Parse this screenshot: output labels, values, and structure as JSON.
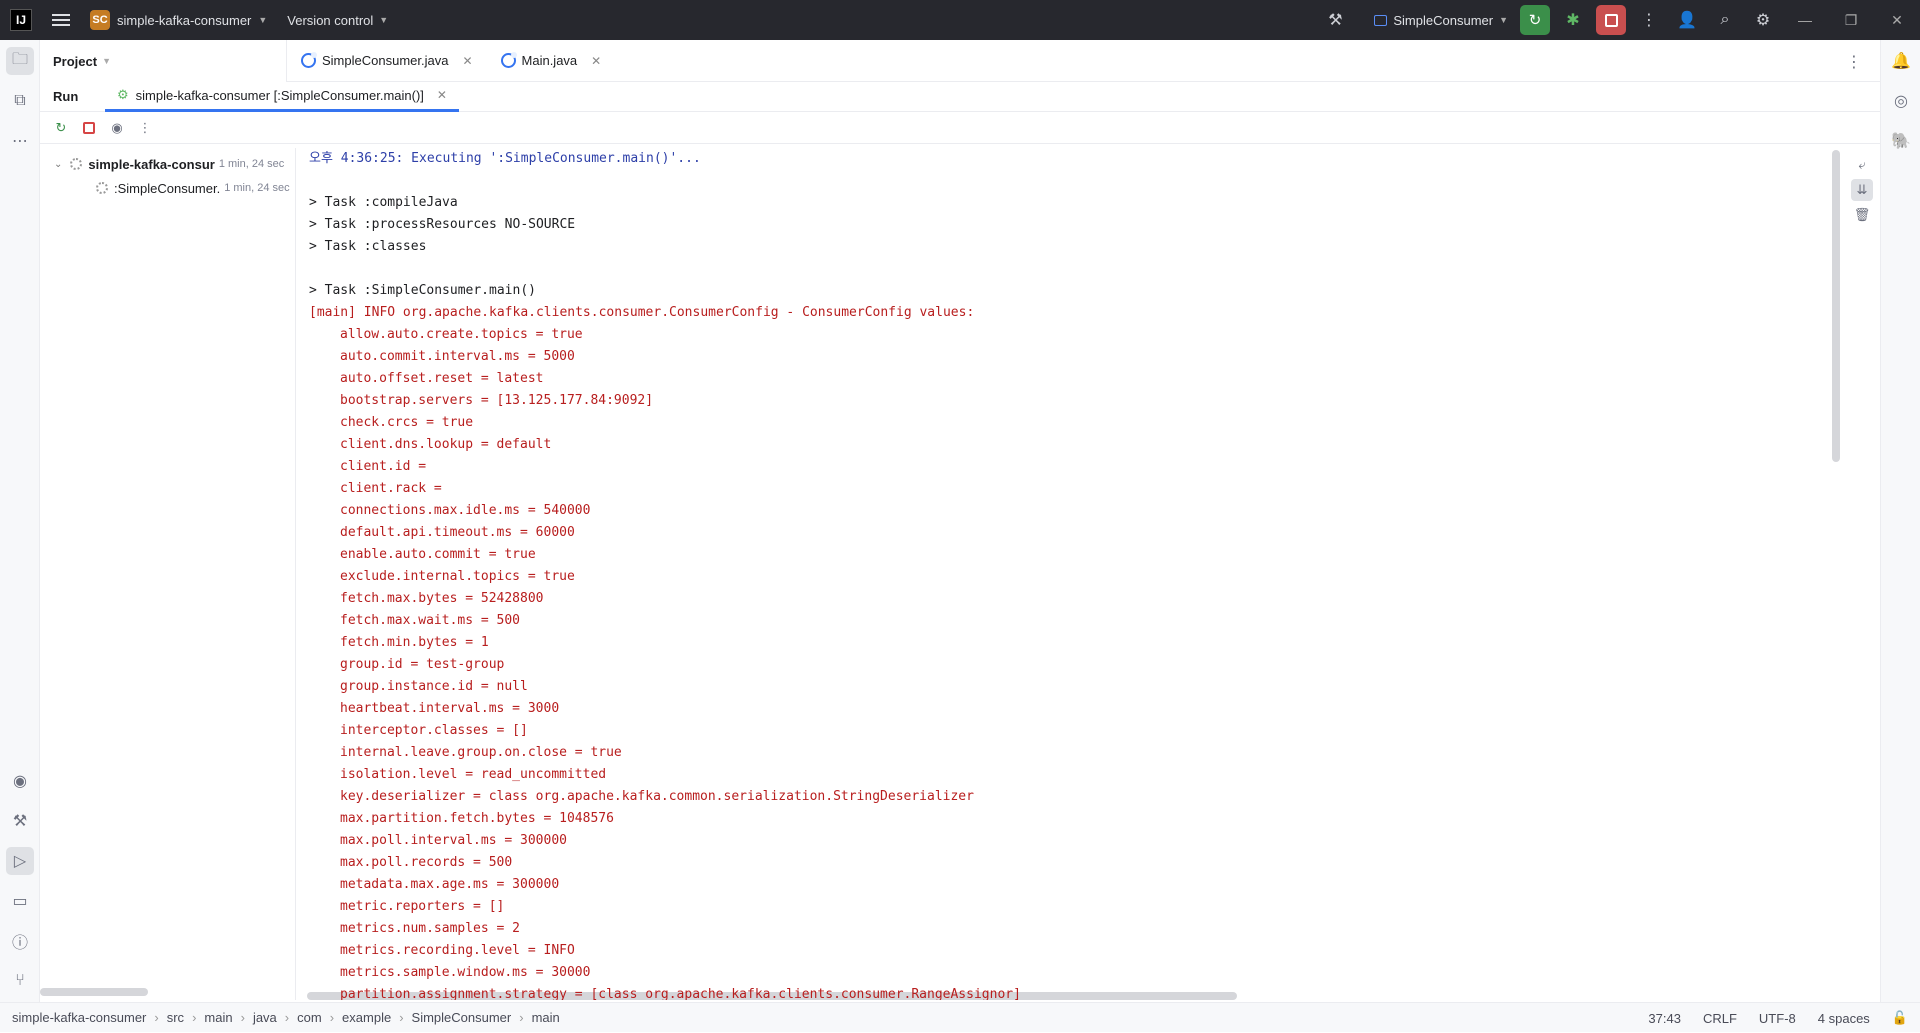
{
  "titlebar": {
    "project_badge": "SC",
    "project_name": "simple-kafka-consumer",
    "vcs_label": "Version control",
    "run_config": "SimpleConsumer"
  },
  "project_panel": {
    "title": "Project"
  },
  "editor_tabs": [
    {
      "label": "SimpleConsumer.java"
    },
    {
      "label": "Main.java"
    }
  ],
  "run_panel": {
    "label": "Run",
    "tab_label": "simple-kafka-consumer [:SimpleConsumer.main()]"
  },
  "tree": {
    "items": [
      {
        "label": "simple-kafka-consur",
        "time": "1 min, 24 sec"
      },
      {
        "label": ":SimpleConsumer.",
        "time": "1 min, 24 sec"
      }
    ]
  },
  "console": {
    "lines": [
      {
        "text": "오후 4:36:25: Executing ':SimpleConsumer.main()'...",
        "style": "blue"
      },
      {
        "text": "",
        "style": "dark"
      },
      {
        "text": "> Task :compileJava",
        "style": "dark"
      },
      {
        "text": "> Task :processResources NO-SOURCE",
        "style": "dark"
      },
      {
        "text": "> Task :classes",
        "style": "dark"
      },
      {
        "text": "",
        "style": "dark"
      },
      {
        "text": "> Task :SimpleConsumer.main()",
        "style": "dark"
      },
      {
        "text": "[main] INFO org.apache.kafka.clients.consumer.ConsumerConfig - ConsumerConfig values:",
        "style": "red"
      },
      {
        "text": "allow.auto.create.topics = true",
        "style": "red-ind"
      },
      {
        "text": "auto.commit.interval.ms = 5000",
        "style": "red-ind"
      },
      {
        "text": "auto.offset.reset = latest",
        "style": "red-ind"
      },
      {
        "text": "bootstrap.servers = [13.125.177.84:9092]",
        "style": "red-ind"
      },
      {
        "text": "check.crcs = true",
        "style": "red-ind"
      },
      {
        "text": "client.dns.lookup = default",
        "style": "red-ind"
      },
      {
        "text": "client.id =",
        "style": "red-ind"
      },
      {
        "text": "client.rack =",
        "style": "red-ind"
      },
      {
        "text": "connections.max.idle.ms = 540000",
        "style": "red-ind"
      },
      {
        "text": "default.api.timeout.ms = 60000",
        "style": "red-ind"
      },
      {
        "text": "enable.auto.commit = true",
        "style": "red-ind"
      },
      {
        "text": "exclude.internal.topics = true",
        "style": "red-ind"
      },
      {
        "text": "fetch.max.bytes = 52428800",
        "style": "red-ind"
      },
      {
        "text": "fetch.max.wait.ms = 500",
        "style": "red-ind"
      },
      {
        "text": "fetch.min.bytes = 1",
        "style": "red-ind"
      },
      {
        "text": "group.id = test-group",
        "style": "red-ind"
      },
      {
        "text": "group.instance.id = null",
        "style": "red-ind"
      },
      {
        "text": "heartbeat.interval.ms = 3000",
        "style": "red-ind"
      },
      {
        "text": "interceptor.classes = []",
        "style": "red-ind"
      },
      {
        "text": "internal.leave.group.on.close = true",
        "style": "red-ind"
      },
      {
        "text": "isolation.level = read_uncommitted",
        "style": "red-ind"
      },
      {
        "text": "key.deserializer = class org.apache.kafka.common.serialization.StringDeserializer",
        "style": "red-ind"
      },
      {
        "text": "max.partition.fetch.bytes = 1048576",
        "style": "red-ind"
      },
      {
        "text": "max.poll.interval.ms = 300000",
        "style": "red-ind"
      },
      {
        "text": "max.poll.records = 500",
        "style": "red-ind"
      },
      {
        "text": "metadata.max.age.ms = 300000",
        "style": "red-ind"
      },
      {
        "text": "metric.reporters = []",
        "style": "red-ind"
      },
      {
        "text": "metrics.num.samples = 2",
        "style": "red-ind"
      },
      {
        "text": "metrics.recording.level = INFO",
        "style": "red-ind"
      },
      {
        "text": "metrics.sample.window.ms = 30000",
        "style": "red-ind"
      },
      {
        "text": "partition.assignment.strategy = [class org.apache.kafka.clients.consumer.RangeAssignor]",
        "style": "red-ind"
      }
    ]
  },
  "breadcrumbs": [
    "simple-kafka-consumer",
    "src",
    "main",
    "java",
    "com",
    "example",
    "SimpleConsumer",
    "main"
  ],
  "status": {
    "position": "37:43",
    "line_sep": "CRLF",
    "encoding": "UTF-8",
    "indent": "4 spaces"
  },
  "colors": {
    "accent": "#3574f0",
    "run_green": "#3b8f4a",
    "stop_red": "#c94f4f",
    "console_red": "#b81e1e",
    "console_blue": "#2d3fa8"
  }
}
